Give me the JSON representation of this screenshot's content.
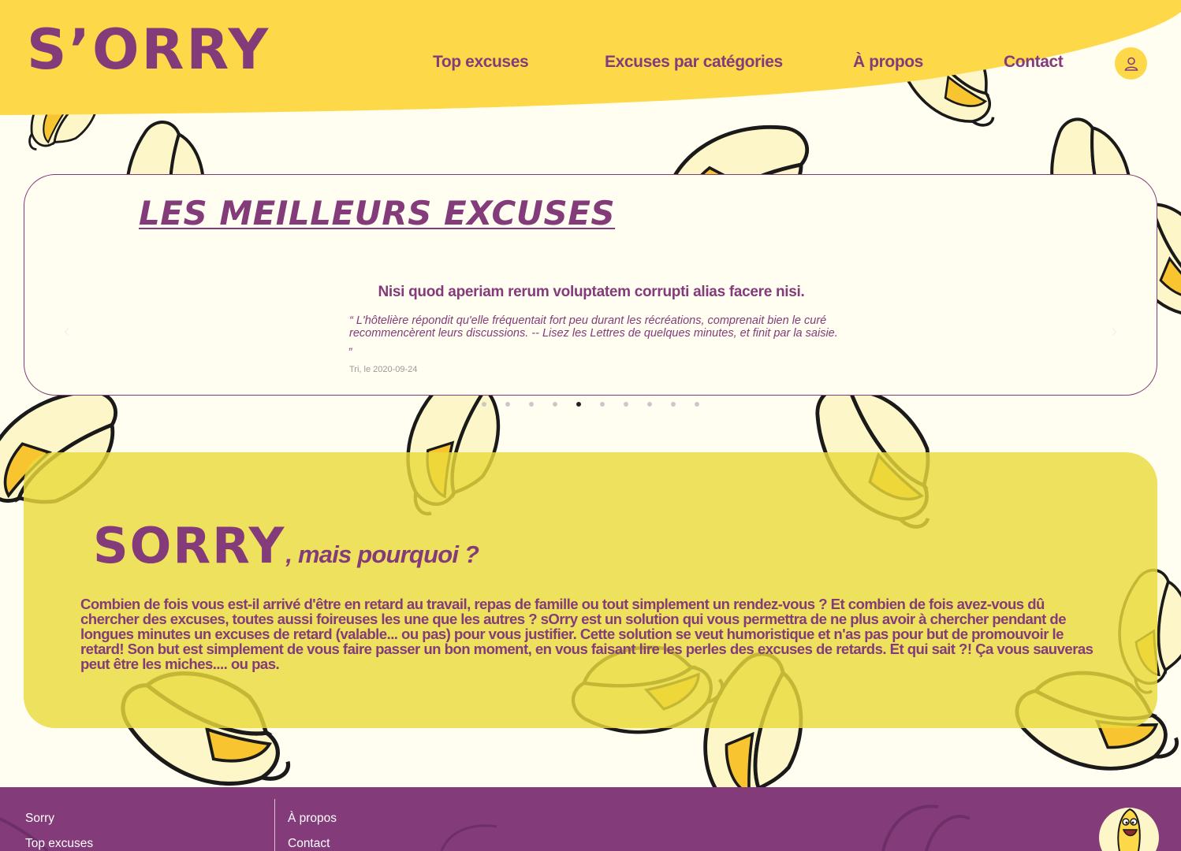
{
  "header": {
    "logo": "S’ORRY",
    "nav": [
      "Top excuses",
      "Excuses par catégories",
      "À propos",
      "Contact"
    ],
    "user_icon": "user-icon"
  },
  "carousel": {
    "heading": "LES MEILLEURS EXCUSES",
    "excuse": {
      "title": "Nisi quod aperiam rerum voluptatem corrupti alias facere nisi.",
      "quote": "“ L'hôtelière répondit qu'elle fréquentait fort peu durant les récréations, comprenait bien le curé recommencèrent leurs discussions. -- Lisez les Lettres de quelques minutes, et finit par la saisie. „",
      "date": "Tri, le 2020-09-24"
    },
    "prev_icon": "chevron-left-icon",
    "next_icon": "chevron-right-icon",
    "slide_count": 10,
    "active_slide": 5
  },
  "about": {
    "title_big": "SORRY",
    "title_small": ", mais pourquoi ?",
    "text": "Combien de fois vous est-il arrivé d'être en retard au travail, repas de famille ou tout simplement un rendez-vous ? Et combien de fois avez-vous dû chercher des excuses, toutes aussi foireuses les une que les autres ? sOrry est un solution qui vous permettra de ne plus avoir à chercher pendant de longues minutes un excuses de retard (valable... ou pas) pour vous justifier. Cette solution se veut humoristique et n'as pas pour but de promouvoir le retard! Son but est simplement de vous faire passer un bon moment, en vous faisant lire les perles des excuses de retards. Et qui sait ?! Ça vous sauveras peut être les miches.... ou pas."
  },
  "footer": {
    "col1": [
      "Sorry",
      "Top excuses"
    ],
    "col2": [
      "À propos",
      "Contact"
    ],
    "mascot_icon": "banana-mascot-icon"
  },
  "colors": {
    "purple": "#833b7a",
    "yellow": "#fdd94a",
    "card_yellow": "#eadf5c",
    "background": "#fffef0"
  }
}
